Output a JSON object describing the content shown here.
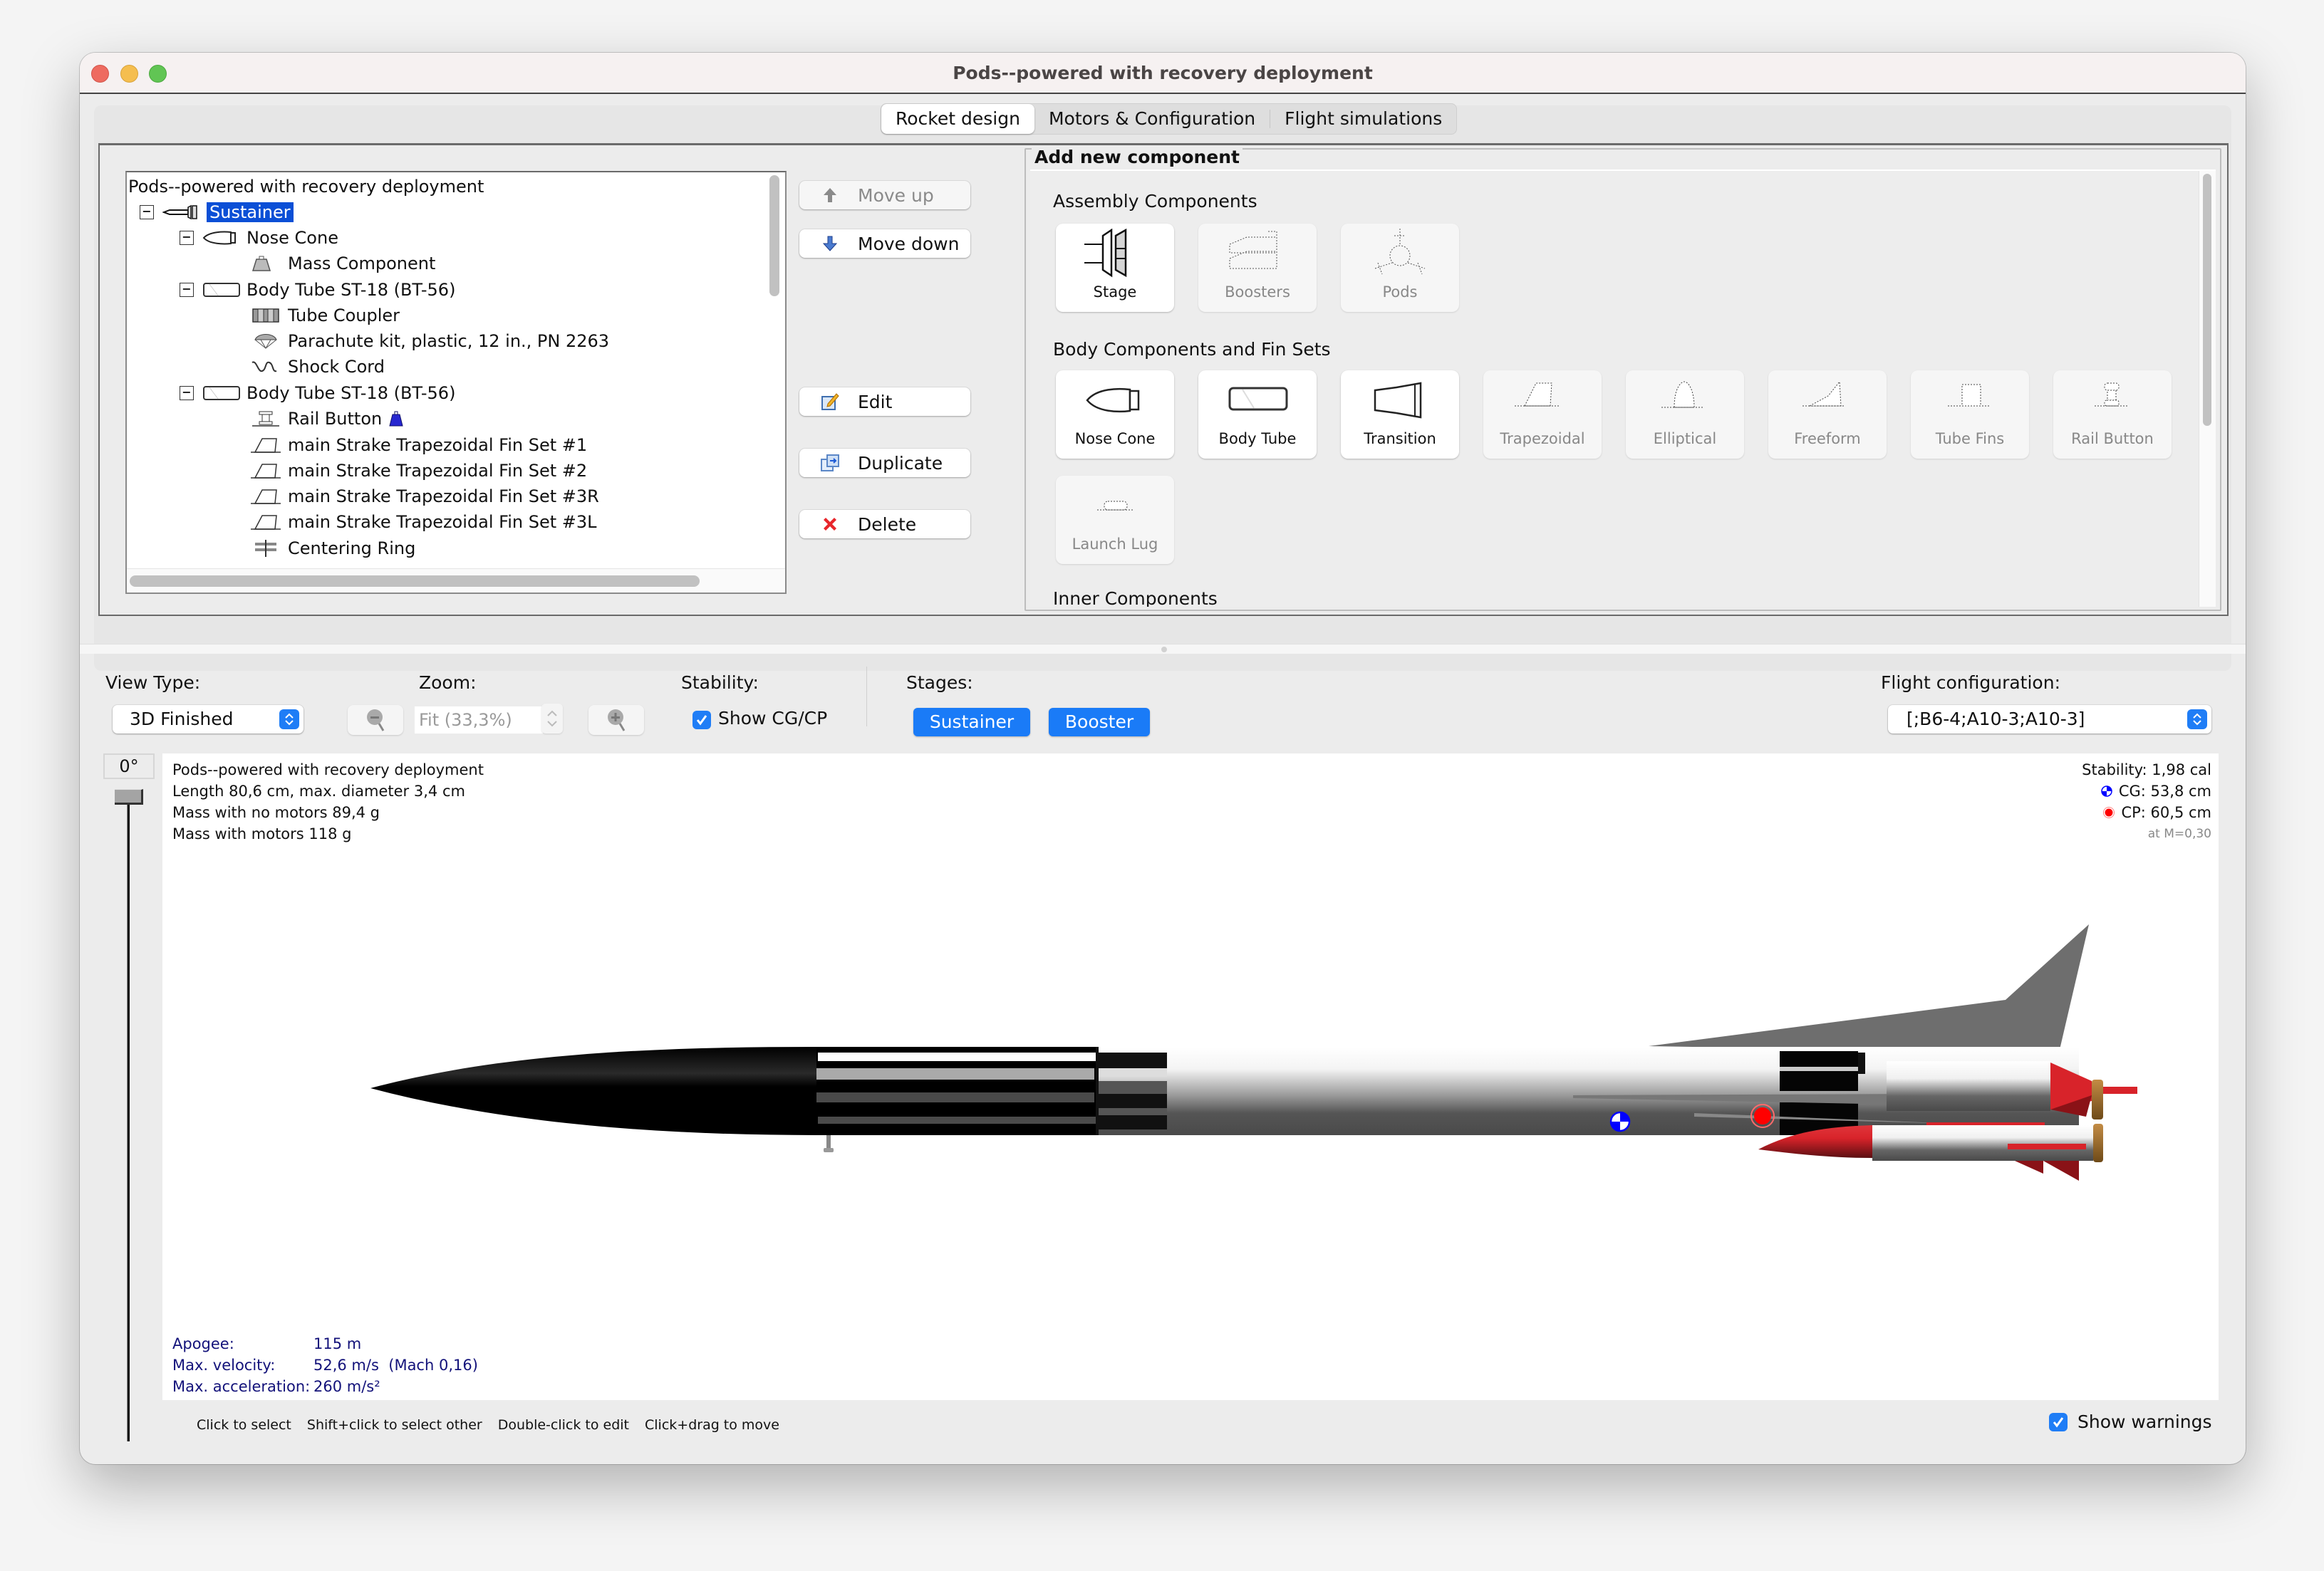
{
  "window": {
    "title": "Pods--powered with recovery deployment"
  },
  "tabs": [
    {
      "label": "Rocket design",
      "active": true
    },
    {
      "label": "Motors & Configuration",
      "active": false
    },
    {
      "label": "Flight simulations",
      "active": false
    }
  ],
  "tree": {
    "root": "Pods--powered with recovery deployment",
    "items": [
      {
        "label": "Sustainer",
        "icon": "stage-icon",
        "level": 0,
        "expanded": true,
        "selected": true
      },
      {
        "label": "Nose Cone",
        "icon": "nose-cone-icon",
        "level": 1,
        "expanded": true
      },
      {
        "label": "Mass Component",
        "icon": "mass-component-icon",
        "level": 2
      },
      {
        "label": "Body Tube ST-18 (BT-56)",
        "icon": "body-tube-icon",
        "level": 1,
        "expanded": true
      },
      {
        "label": "Tube Coupler",
        "icon": "tube-coupler-icon",
        "level": 2
      },
      {
        "label": "Parachute kit, plastic, 12 in., PN 2263",
        "icon": "parachute-icon",
        "level": 2
      },
      {
        "label": "Shock Cord",
        "icon": "shock-cord-icon",
        "level": 2
      },
      {
        "label": "Body Tube ST-18 (BT-56)",
        "icon": "body-tube-icon",
        "level": 1,
        "expanded": true
      },
      {
        "label": "Rail Button",
        "icon": "rail-button-icon",
        "level": 2,
        "badge": "mass-override-icon"
      },
      {
        "label": "main Strake Trapezoidal Fin Set #1",
        "icon": "trapezoidal-fin-icon",
        "level": 2
      },
      {
        "label": "main Strake Trapezoidal Fin Set #2",
        "icon": "trapezoidal-fin-icon",
        "level": 2
      },
      {
        "label": "main Strake Trapezoidal Fin Set #3R",
        "icon": "trapezoidal-fin-icon",
        "level": 2
      },
      {
        "label": "main Strake Trapezoidal Fin Set #3L",
        "icon": "trapezoidal-fin-icon",
        "level": 2
      },
      {
        "label": "Centering Ring",
        "icon": "centering-ring-icon",
        "level": 2
      }
    ]
  },
  "actions": {
    "move_up": "Move up",
    "move_down": "Move down",
    "edit": "Edit",
    "duplicate": "Duplicate",
    "delete": "Delete"
  },
  "add_component": {
    "title": "Add new component",
    "sections": [
      {
        "label": "Assembly Components",
        "items": [
          {
            "label": "Stage",
            "enabled": true
          },
          {
            "label": "Boosters",
            "enabled": false
          },
          {
            "label": "Pods",
            "enabled": false
          }
        ]
      },
      {
        "label": "Body Components and Fin Sets",
        "items": [
          {
            "label": "Nose Cone",
            "enabled": true
          },
          {
            "label": "Body Tube",
            "enabled": true
          },
          {
            "label": "Transition",
            "enabled": true
          },
          {
            "label": "Trapezoidal",
            "enabled": false
          },
          {
            "label": "Elliptical",
            "enabled": false
          },
          {
            "label": "Freeform",
            "enabled": false
          },
          {
            "label": "Tube Fins",
            "enabled": false
          },
          {
            "label": "Rail Button",
            "enabled": false
          },
          {
            "label": "Launch Lug",
            "enabled": false
          }
        ]
      },
      {
        "label": "Inner Components",
        "items": []
      }
    ]
  },
  "controls": {
    "view_type_label": "View Type:",
    "view_type_value": "3D Finished",
    "zoom_label": "Zoom:",
    "zoom_value": "Fit (33,3%)",
    "stability_label": "Stability:",
    "show_cgcp_label": "Show CG/CP",
    "show_cgcp_checked": true,
    "stages_label": "Stages:",
    "stages": [
      "Sustainer",
      "Booster"
    ],
    "flight_config_label": "Flight configuration:",
    "flight_config_value": "[;B6-4;A10-3;A10-3]"
  },
  "viewer": {
    "rotation": "0°",
    "info": [
      "Pods--powered with recovery deployment",
      "Length 80,6 cm, max. diameter 3,4 cm",
      "Mass with no motors 89,4 g",
      "Mass with motors 118 g"
    ],
    "stability": {
      "stability": "Stability: 1,98 cal",
      "cg": "CG: 53,8 cm",
      "cp": "CP: 60,5 cm",
      "mach": "at M=0,30"
    },
    "flight": [
      {
        "key": "Apogee:",
        "value": "115 m"
      },
      {
        "key": "Max. velocity:",
        "value": "52,6 m/s  (Mach 0,16)"
      },
      {
        "key": "Max. acceleration:",
        "value": "260 m/s²"
      }
    ],
    "colors": {
      "cg": "#0000ff",
      "cp": "#ff0000",
      "fin": "#6e6e6e",
      "nose": "#000000",
      "pod_nose": "#d8232a",
      "motor_cap": "#b07a35"
    }
  },
  "status": {
    "hints": [
      "Click to select",
      "Shift+click to select other",
      "Double-click to edit",
      "Click+drag to move"
    ],
    "show_warnings_label": "Show warnings",
    "show_warnings_checked": true
  }
}
